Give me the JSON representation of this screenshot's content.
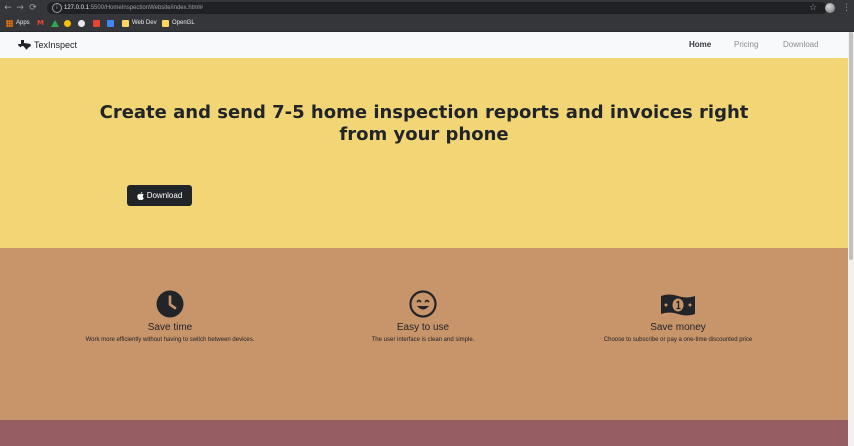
{
  "browser": {
    "url_host": "127.0.0.1",
    "url_path": ":5500/HomeInspectionWebsite/index.html#",
    "bookmarks": [
      {
        "label": "Apps",
        "icon": "apps-grid-icon",
        "color": "#e8710a"
      },
      {
        "label": "",
        "icon": "gmail-icon",
        "color": "#ea4335"
      },
      {
        "label": "",
        "icon": "drive-icon",
        "color": "#34a853"
      },
      {
        "label": "",
        "icon": "bookmark-icon",
        "color": "#fbbc04"
      },
      {
        "label": "",
        "icon": "github-icon",
        "color": "#e8eaed"
      },
      {
        "label": "",
        "icon": "bookmark-icon",
        "color": "#ea4335"
      },
      {
        "label": "",
        "icon": "bookmark-icon",
        "color": "#4285f4"
      },
      {
        "label": "Web Dev",
        "icon": "folder-icon",
        "color": "#fdd663"
      },
      {
        "label": "OpenGL",
        "icon": "folder-icon",
        "color": "#fdd663"
      }
    ]
  },
  "site": {
    "brand": "TexInspect",
    "nav": [
      {
        "label": "Home",
        "active": true
      },
      {
        "label": "Pricing",
        "active": false
      },
      {
        "label": "Download",
        "active": false
      }
    ],
    "hero": {
      "title": "Create and send 7-5 home inspection reports and invoices right from your phone",
      "download_label": "Download"
    },
    "features": [
      {
        "icon": "clock-icon",
        "title": "Save time",
        "desc": "Work more efficiently without having to switch between devices."
      },
      {
        "icon": "smile-icon",
        "title": "Easy to use",
        "desc": "The user interface is clean and simple."
      },
      {
        "icon": "money-bill-icon",
        "title": "Save money",
        "desc": "Choose to subscribe or pay a one-time discounted price"
      }
    ]
  },
  "colors": {
    "hero_bg": "#f2d675",
    "features_bg": "#c8946a",
    "next_section_bg": "#965e63",
    "dark": "#212529"
  }
}
